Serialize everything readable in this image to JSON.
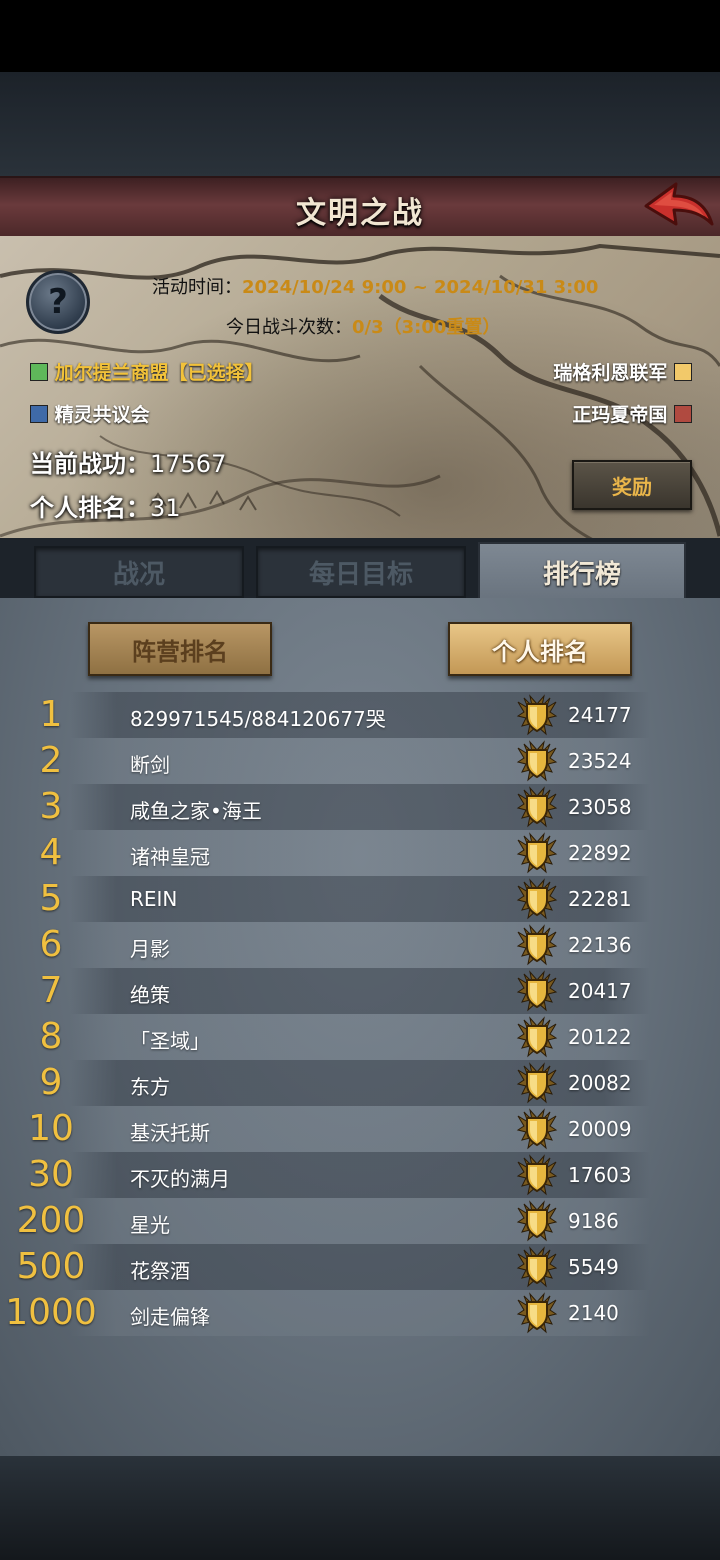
{
  "header": {
    "title": "文明之战",
    "back_icon": "back-arrow-icon"
  },
  "event": {
    "time_label": "活动时间：",
    "time_value": "2024/10/24 9:00 ~ 2024/10/31 3:00",
    "battles_label": "今日战斗次数：",
    "battles_value": "0/3（3:00重置）"
  },
  "factions": {
    "left": [
      {
        "name": "加尔提兰商盟【已选择】",
        "color": "#5fb85a",
        "text_color": "#f2c23a"
      },
      {
        "name": "精灵共议会",
        "color": "#3f6aa8",
        "text_color": "#ffffff"
      }
    ],
    "right": [
      {
        "name": "瑞格利恩联军",
        "color": "#f2c96a",
        "text_color": "#ffffff"
      },
      {
        "name": "正玛夏帝国",
        "color": "#b04a40",
        "text_color": "#ffffff"
      }
    ]
  },
  "stats": {
    "merit_label": "当前战功：",
    "merit_value": "17567",
    "rank_label": "个人排名：",
    "rank_value": "31"
  },
  "reward_button": "奖励",
  "tabs": [
    {
      "label": "战况",
      "active": false
    },
    {
      "label": "每日目标",
      "active": false
    },
    {
      "label": "排行榜",
      "active": true
    }
  ],
  "subtabs": {
    "faction": "阵营排名",
    "personal": "个人排名"
  },
  "ranking": [
    {
      "rank": "1",
      "name": "829971545/884120677哭",
      "score": "24177"
    },
    {
      "rank": "2",
      "name": "断剑",
      "score": "23524"
    },
    {
      "rank": "3",
      "name": "咸鱼之家•海王",
      "score": "23058"
    },
    {
      "rank": "4",
      "name": "诸神皇冠",
      "score": "22892"
    },
    {
      "rank": "5",
      "name": "REIN",
      "score": "22281"
    },
    {
      "rank": "6",
      "name": "月影",
      "score": "22136"
    },
    {
      "rank": "7",
      "name": "绝策",
      "score": "20417"
    },
    {
      "rank": "8",
      "name": "「圣域」",
      "score": "20122"
    },
    {
      "rank": "9",
      "name": "东方",
      "score": "20082"
    },
    {
      "rank": "10",
      "name": "基沃托斯",
      "score": "20009"
    },
    {
      "rank": "30",
      "name": "不灭的满月",
      "score": "17603"
    },
    {
      "rank": "200",
      "name": "星光",
      "score": "9186"
    },
    {
      "rank": "500",
      "name": "花祭酒",
      "score": "5549"
    },
    {
      "rank": "1000",
      "name": "剑走偏锋",
      "score": "2140"
    }
  ],
  "ranking_icon": "gold-shield-medal-icon"
}
